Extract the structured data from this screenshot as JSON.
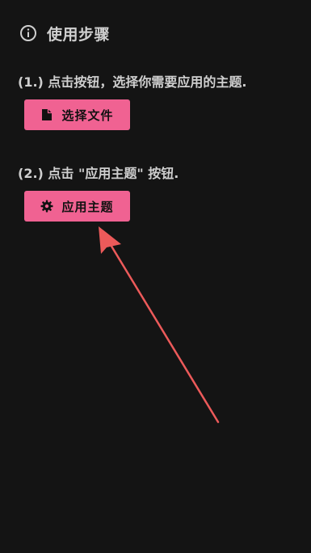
{
  "header": {
    "title": "使用步骤",
    "icon": "info-circle-icon"
  },
  "steps": [
    {
      "label": "(1.) 点击按钮，选择你需要应用的主题.",
      "button_label": "选择文件",
      "button_icon": "file-icon"
    },
    {
      "label": "(2.) 点击 \"应用主题\" 按钮.",
      "button_label": "应用主题",
      "button_icon": "gear-icon"
    }
  ],
  "colors": {
    "background": "#141414",
    "accent": "#f06292",
    "arrow": "#ec5a5a",
    "text": "#cfcfcf"
  }
}
